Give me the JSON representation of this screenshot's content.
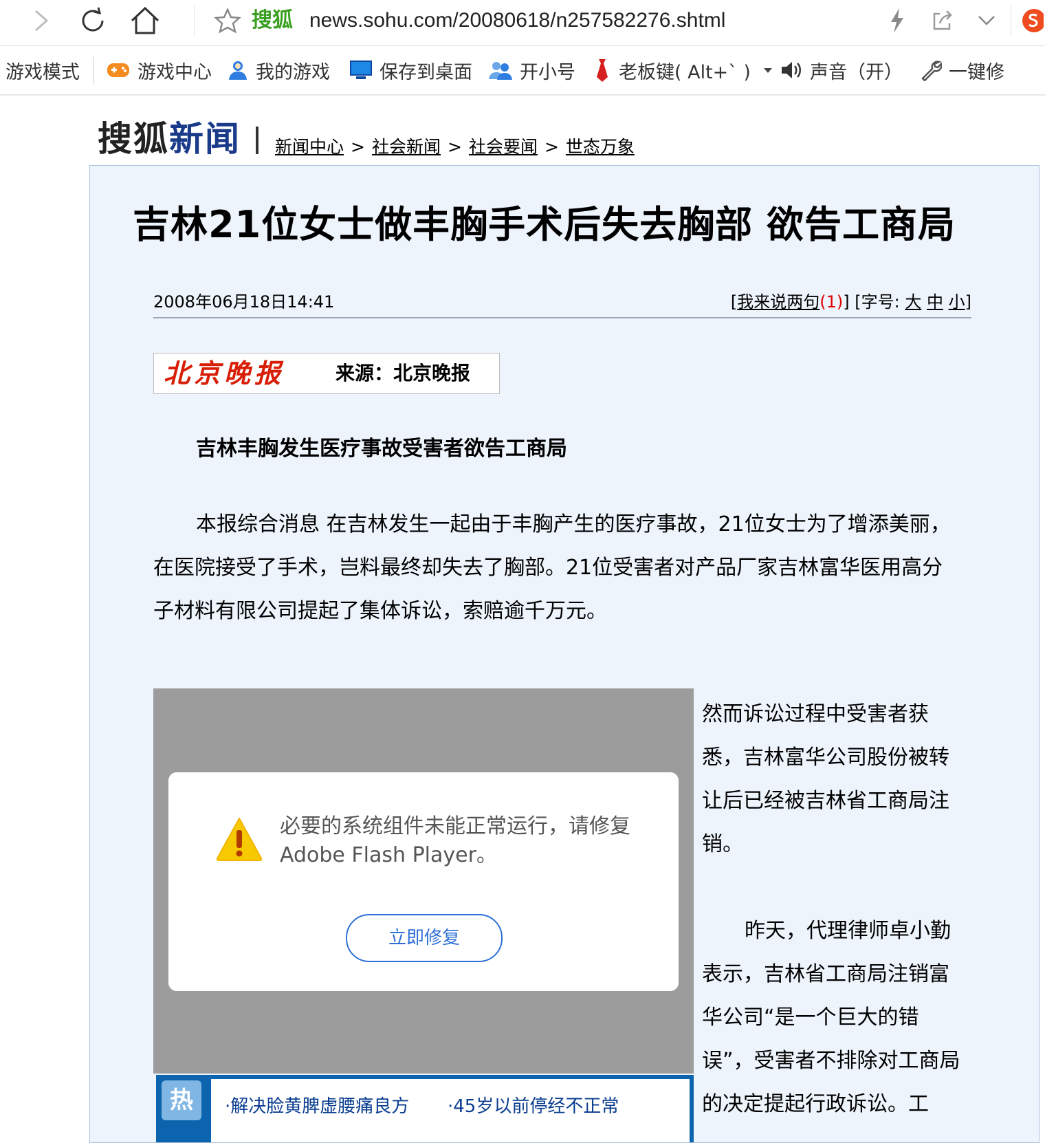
{
  "browser": {
    "brand": "搜狐",
    "url": "news.sohu.com/20080618/n257582276.shtml"
  },
  "bookmarks": [
    {
      "label": "游戏模式",
      "icon": "none"
    },
    {
      "label": "游戏中心",
      "icon": "gamepad-icon"
    },
    {
      "label": "我的游戏",
      "icon": "user-icon"
    },
    {
      "label": "保存到桌面",
      "icon": "monitor-icon"
    },
    {
      "label": "开小号",
      "icon": "users-icon"
    },
    {
      "label": "老板键( Alt+` )",
      "icon": "tie-icon"
    },
    {
      "label": "声音（开）",
      "icon": "speaker-icon"
    },
    {
      "label": "一键修",
      "icon": "wrench-icon"
    }
  ],
  "site": {
    "logo_a": "搜狐",
    "logo_b": "新闻",
    "breadcrumbs": [
      "新闻中心",
      "社会新闻",
      "社会要闻",
      "世态万象"
    ],
    "separator": ">"
  },
  "article": {
    "title": "吉林21位女士做丰胸手术后失去胸部 欲告工商局",
    "date": "2008年06月18日14:41",
    "tools": {
      "comment_open": "[",
      "comment_label": "我来说两句",
      "comment_count": "(1)",
      "comment_close": "]",
      "font_label": " [字号:",
      "size_large": "大",
      "size_medium": "中",
      "size_small": "小",
      "font_close": "]"
    },
    "source_logo": "北京晚报",
    "source_text": "来源：北京晚报",
    "subhead": "吉林丰胸发生医疗事故受害者欲告工商局",
    "para1": "本报综合消息 在吉林发生一起由于丰胸产生的医疗事故，21位女士为了增添美丽，在医院接受了手术，岂料最终却失去了胸部。21位受害者对产品厂家吉林富华医用高分子材料有限公司提起了集体诉讼，索赔逾千万元。",
    "side_para1": "然而诉讼过程中受害者获悉，吉林富华公司股份被转让后已经被吉林省工商局注销。",
    "side_para2": "昨天，代理律师卓小勤表示，吉林省工商局注销富华公司“是一个巨大的错误”，受害者不排除对工商局的决定提起行政诉讼。工"
  },
  "flash": {
    "message": "必要的系统组件未能正常运行，请修复 Adobe Flash Player。",
    "button": "立即修复"
  },
  "hot": {
    "badge": "热",
    "links": [
      "·解决脸黄脾虚腰痛良方",
      "·45岁以前停经不正常"
    ]
  },
  "colors": {
    "panel_bg": "#eef4fc",
    "accent_blue": "#2d6fd6",
    "brand_green": "#3aa021",
    "alert_red": "#d00000"
  }
}
